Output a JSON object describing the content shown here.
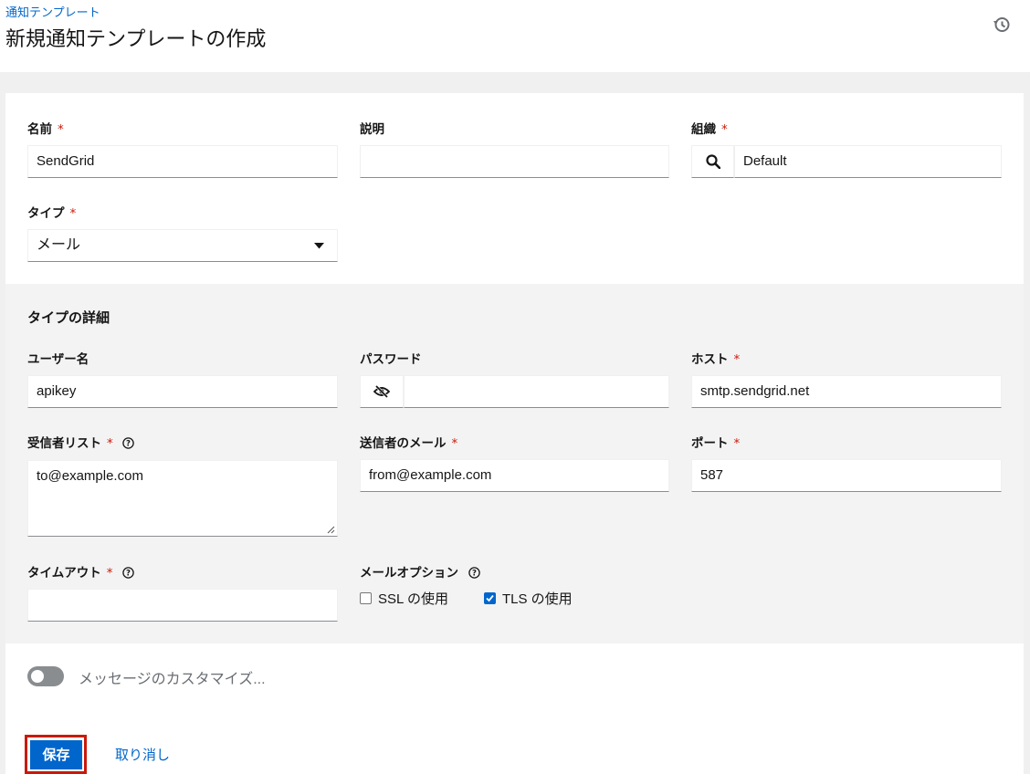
{
  "header": {
    "breadcrumb": "通知テンプレート",
    "title": "新規通知テンプレートの作成",
    "history_icon": "history-icon"
  },
  "form": {
    "name": {
      "label": "名前",
      "required": "*",
      "value": "SendGrid"
    },
    "description": {
      "label": "説明",
      "value": ""
    },
    "organization": {
      "label": "組織",
      "required": "*",
      "value": "Default",
      "icon": "search-icon"
    },
    "type": {
      "label": "タイプ",
      "required": "*",
      "value": "メール"
    }
  },
  "details": {
    "title": "タイプの詳細",
    "username": {
      "label": "ユーザー名",
      "value": "apikey"
    },
    "password": {
      "label": "パスワード",
      "value": "",
      "icon": "eye-slash-icon"
    },
    "host": {
      "label": "ホスト",
      "required": "*",
      "value": "smtp.sendgrid.net"
    },
    "recipients": {
      "label": "受信者リスト",
      "required": "*",
      "value": "to@example.com"
    },
    "sender": {
      "label": "送信者のメール",
      "required": "*",
      "value": "from@example.com"
    },
    "port": {
      "label": "ポート",
      "required": "*",
      "value": "587"
    },
    "timeout": {
      "label": "タイムアウト",
      "required": "*",
      "value": ""
    },
    "email_options": {
      "label": "メールオプション",
      "ssl": {
        "label": "SSL の使用",
        "checked": false
      },
      "tls": {
        "label": "TLS の使用",
        "checked": true
      }
    }
  },
  "customize": {
    "label": "メッセージのカスタマイズ...",
    "enabled": false
  },
  "actions": {
    "save": "保存",
    "cancel": "取り消し"
  },
  "colors": {
    "primary": "#0066cc",
    "required": "#c9190b",
    "highlight": "#c9190b"
  }
}
